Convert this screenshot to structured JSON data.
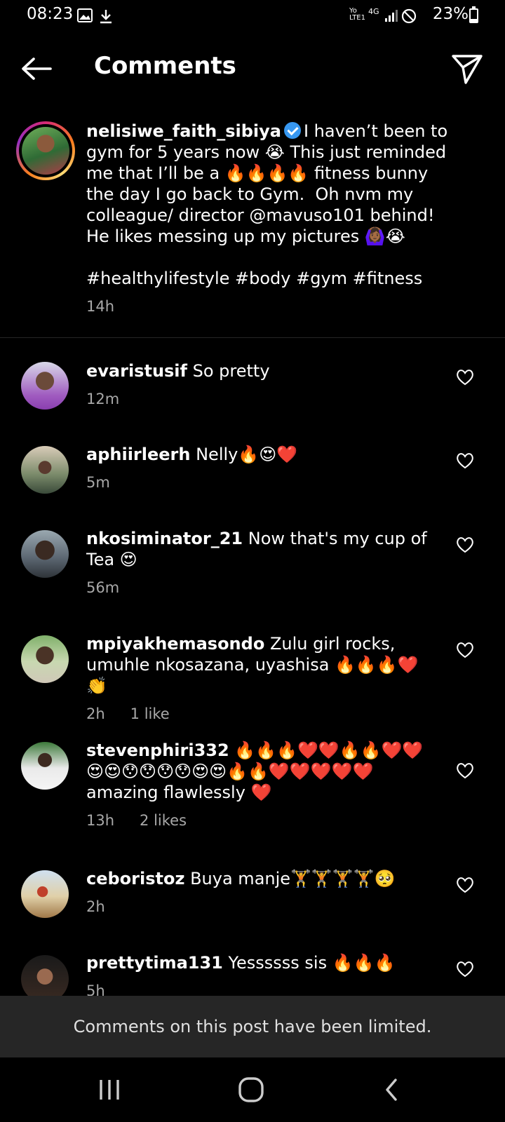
{
  "status_bar": {
    "time": "08:23",
    "network": "4G",
    "carrier_label": "Yo LTE1",
    "battery": "23%",
    "battery_level": 0.23,
    "icons": [
      "image-icon",
      "download-icon",
      "signal-icon",
      "do-not-disturb-icon",
      "battery-icon"
    ]
  },
  "header": {
    "title": "Comments",
    "back_icon": "arrow-left-icon",
    "share_icon": "send-icon"
  },
  "caption": {
    "username": "nelisiwe_faith_sibiya",
    "verified": true,
    "text": "I haven’t been to gym for 5 years now 😭 This just reminded me that I’ll be a 🔥🔥🔥🔥 fitness bunny the day I go back to Gym.  Oh nvm my colleague/ director @mavuso101 behind! He likes messing up my pictures 🙆🏾‍♀️😭",
    "hashtags": "#healthylifestyle #body #gym #fitness",
    "time": "14h"
  },
  "comments": [
    {
      "username": "evaristusif",
      "text": "So pretty",
      "time": "12m",
      "likes": ""
    },
    {
      "username": "aphiirleerh",
      "text": "Nelly🔥😍❤️",
      "time": "5m",
      "likes": ""
    },
    {
      "username": "nkosiminator_21",
      "text": "Now that's my cup of Tea 😍",
      "time": "56m",
      "likes": ""
    },
    {
      "username": "mpiyakhemasondo",
      "text": "Zulu girl rocks, umuhle nkosazana, uyashisa 🔥🔥🔥❤️👏",
      "time": "2h",
      "likes": "1 like"
    },
    {
      "username": "stevenphiri332",
      "text": "🔥🔥🔥❤️❤️🔥🔥❤️❤️😍😍😯😯😯😯😍😍🔥🔥❤️❤️❤️❤️❤️ amazing flawlessly ❤️",
      "time": "13h",
      "likes": "2 likes"
    },
    {
      "username": "ceboristoz",
      "text": "Buya manje🏋️🏋️🏋️🏋️🥺",
      "time": "2h",
      "likes": ""
    },
    {
      "username": "prettytima131",
      "text": "Yessssss sis 🔥🔥🔥",
      "time": "5h",
      "likes": ""
    }
  ],
  "footer": {
    "limited_notice": "Comments on this post have been limited."
  },
  "nav_bar": {
    "icons": [
      "recent-apps-icon",
      "home-icon",
      "back-icon"
    ]
  }
}
